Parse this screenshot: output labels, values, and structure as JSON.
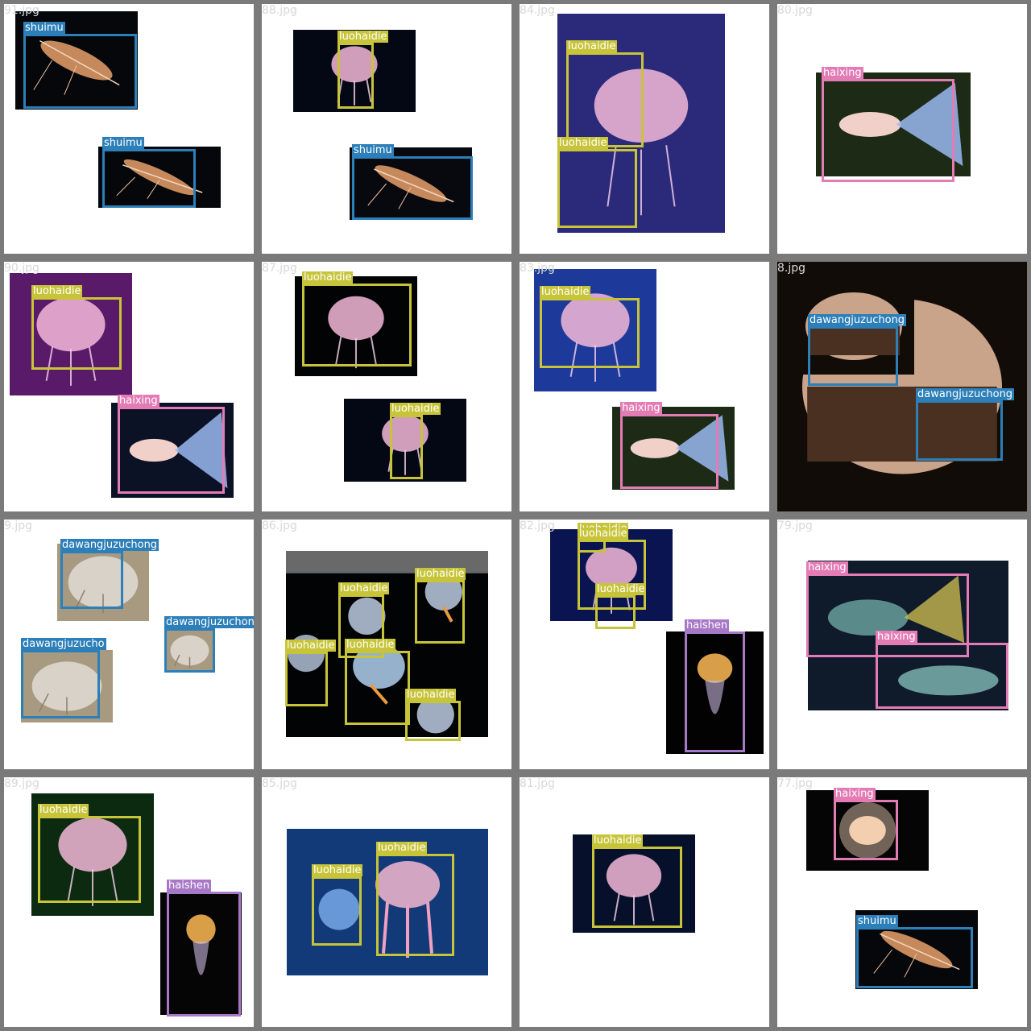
{
  "class_colors": {
    "shuimu": "#2c7fb8",
    "luohaidie": "#c7c43a",
    "haixing": "#e37bb5",
    "dawangjuzuchong": "#2c7fb8",
    "haishen": "#a878c8"
  },
  "tiles": [
    {
      "filename": "91.jpg",
      "images": [
        {
          "subject": "shrimp",
          "bg": "#05070a",
          "labels": [
            "shuimu"
          ]
        },
        {
          "subject": "shrimp",
          "bg": "#05070a",
          "labels": [
            "shuimu"
          ]
        }
      ]
    },
    {
      "filename": "88.jpg",
      "images": [
        {
          "subject": "jellyfish",
          "bg": "#040814",
          "labels": [
            "luohaidie"
          ]
        },
        {
          "subject": "shrimp",
          "bg": "#07090e",
          "labels": [
            "shuimu"
          ]
        }
      ]
    },
    {
      "filename": "84.jpg",
      "images": [
        {
          "subject": "jellyfish",
          "bg": "#2b2a7a",
          "labels": [
            "luohaidie",
            "luohaidie"
          ]
        }
      ]
    },
    {
      "filename": "80.jpg",
      "images": [
        {
          "subject": "fish",
          "bg": "#1d2b16",
          "labels": [
            "haixing"
          ]
        }
      ]
    },
    {
      "filename": "90.jpg",
      "images": [
        {
          "subject": "jellyfish",
          "bg": "#5a1a6a",
          "labels": [
            "luohaidie"
          ]
        },
        {
          "subject": "fish",
          "bg": "#0c1226",
          "labels": [
            "haixing"
          ]
        }
      ]
    },
    {
      "filename": "87.jpg",
      "images": [
        {
          "subject": "jellyfish",
          "bg": "#020305",
          "labels": [
            "luohaidie"
          ]
        },
        {
          "subject": "jellyfish",
          "bg": "#040814",
          "labels": [
            "luohaidie"
          ]
        }
      ]
    },
    {
      "filename": "83.jpg",
      "images": [
        {
          "subject": "jellyfish",
          "bg": "#1d3a9a",
          "labels": [
            "luohaidie"
          ]
        },
        {
          "subject": "fish",
          "bg": "#1d2b16",
          "labels": [
            "haixing"
          ]
        }
      ]
    },
    {
      "filename": "8.jpg",
      "images": [
        {
          "subject": "isopod",
          "bg": "#120c08",
          "labels": [
            "dawangjuzuchong"
          ]
        },
        {
          "subject": "isopod",
          "bg": "#120c08",
          "labels": [
            "dawangjuzuchong"
          ]
        }
      ]
    },
    {
      "filename": "9.jpg",
      "images": [
        {
          "subject": "isopod-sand",
          "bg": "#a89a80",
          "labels": [
            "dawangjuzuchong"
          ]
        },
        {
          "subject": "isopod-sand",
          "bg": "#a89a80",
          "labels": [
            "dawangjuzucho"
          ]
        },
        {
          "subject": "isopod-sand",
          "bg": "#a89a80",
          "labels": [
            "dawangjuzuchong"
          ]
        }
      ]
    },
    {
      "filename": "86.jpg",
      "images": [
        {
          "subject": "jellyfish-group",
          "bg": "#020304",
          "labels": [
            "luohaidie",
            "luohaidie",
            "luohaidie",
            "luohaidie",
            "luohaidie"
          ]
        }
      ]
    },
    {
      "filename": "82.jpg",
      "images": [
        {
          "subject": "jellyfish",
          "bg": "#0a1450",
          "labels": [
            "luohaidie",
            "luohaidie",
            "luohaidie"
          ]
        },
        {
          "subject": "sea-angel",
          "bg": "#020202",
          "labels": [
            "haishen"
          ]
        }
      ]
    },
    {
      "filename": "79.jpg",
      "images": [
        {
          "subject": "fish-pair",
          "bg": "#0f1a2a",
          "labels": [
            "haixing",
            "haixing"
          ]
        }
      ]
    },
    {
      "filename": "89.jpg",
      "images": [
        {
          "subject": "jellyfish",
          "bg": "#0b2a10",
          "labels": [
            "luohaidie"
          ]
        },
        {
          "subject": "sea-angel",
          "bg": "#050505",
          "labels": [
            "haishen"
          ]
        }
      ]
    },
    {
      "filename": "85.jpg",
      "images": [
        {
          "subject": "jellyfish-pair",
          "bg": "#123a78",
          "labels": [
            "luohaidie",
            "luohaidie"
          ]
        }
      ]
    },
    {
      "filename": "81.jpg",
      "images": [
        {
          "subject": "jellyfish",
          "bg": "#06102a",
          "labels": [
            "luohaidie"
          ]
        }
      ]
    },
    {
      "filename": "77.jpg",
      "images": [
        {
          "subject": "betta",
          "bg": "#050505",
          "labels": [
            "haixing"
          ]
        },
        {
          "subject": "shrimp",
          "bg": "#05070a",
          "labels": [
            "shuimu"
          ]
        }
      ]
    }
  ]
}
